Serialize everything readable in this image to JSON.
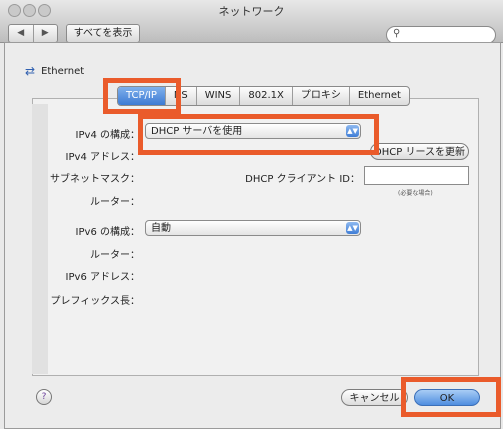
{
  "window": {
    "title": "ネットワーク"
  },
  "toolbar": {
    "back": "◀",
    "forward": "▶",
    "show_all": "すべてを表示",
    "search_placeholder": ""
  },
  "interface": {
    "name": "Ethernet"
  },
  "tabs": [
    "TCP/IP",
    "NS",
    "WINS",
    "802.1X",
    "プロキシ",
    "Ethernet"
  ],
  "tcpip": {
    "ipv4_config_label": "IPv4 の構成：",
    "ipv4_config_value": "DHCP サーバを使用",
    "ipv4_address_label": "IPv4 アドレス：",
    "subnet_label": "サブネットマスク：",
    "router_label": "ルーター：",
    "renew_button": "DHCP リースを更新",
    "dhcp_client_id_label": "DHCP クライアント ID：",
    "dhcp_client_id_note": "(必要な場合)",
    "ipv6_config_label": "IPv6 の構成：",
    "ipv6_config_value": "自動",
    "ipv6_router_label": "ルーター：",
    "ipv6_address_label": "IPv6 アドレス：",
    "prefix_label": "プレフィックス長："
  },
  "footer": {
    "help": "?",
    "cancel": "キャンセル",
    "ok": "OK"
  },
  "colors": {
    "highlight": "#ea5b2b",
    "accent": "#3d7bd4"
  }
}
